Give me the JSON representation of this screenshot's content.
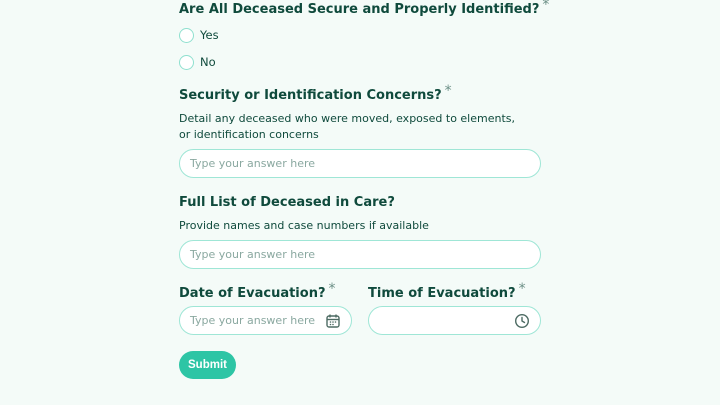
{
  "q_secure": {
    "title": "Are All Deceased Secure and Properly Identified?",
    "required_mark": "*",
    "options": [
      {
        "label": "Yes"
      },
      {
        "label": "No"
      }
    ]
  },
  "q_concerns": {
    "title": "Security or Identification Concerns?",
    "required_mark": "*",
    "description": "Detail any deceased who were moved, exposed to elements, or identification concerns",
    "placeholder": "Type your answer here"
  },
  "q_list": {
    "title": "Full List of Deceased in Care?",
    "description": "Provide names and case numbers if available",
    "placeholder": "Type your answer here"
  },
  "q_date": {
    "title": "Date of Evacuation?",
    "required_mark": "*",
    "placeholder": "Type your answer here",
    "icon": "calendar-icon"
  },
  "q_time": {
    "title": "Time of Evacuation?",
    "required_mark": "*",
    "value": "",
    "icon": "clock-icon"
  },
  "submit_label": "Submit",
  "colors": {
    "accent": "#2dc5a5",
    "border": "#9fe6d6",
    "text": "#0f4a3c",
    "background": "#f4fbf8"
  }
}
